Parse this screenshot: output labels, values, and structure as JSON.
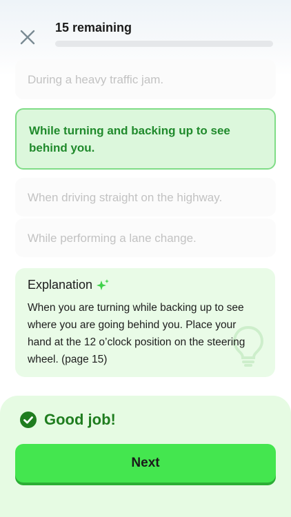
{
  "header": {
    "remaining_label": "15 remaining",
    "progress_fraction": 0.0
  },
  "options": [
    {
      "text": "During a heavy traffic jam.",
      "state": "dimmed"
    },
    {
      "text": "While turning and backing up to see behind you.",
      "state": "correct"
    },
    {
      "text": "When driving straight on the highway.",
      "state": "dimmed"
    },
    {
      "text": "While performing a lane change.",
      "state": "dimmed"
    }
  ],
  "explanation": {
    "title": "Explanation",
    "title_icon": "sparkle-icon",
    "body": "When you are turning while backing up to see where you are going behind you. Place your hand at the 12 o’clock position on the steering wheel. (page 15)",
    "decor_icon": "lightbulb-icon"
  },
  "feedback": {
    "icon": "check-circle-icon",
    "text": "Good job!"
  },
  "next_button": {
    "label": "Next"
  },
  "colors": {
    "accent_green": "#44e64f",
    "correct_text": "#208a2c",
    "feedback_bg": "#e6fbe3"
  }
}
